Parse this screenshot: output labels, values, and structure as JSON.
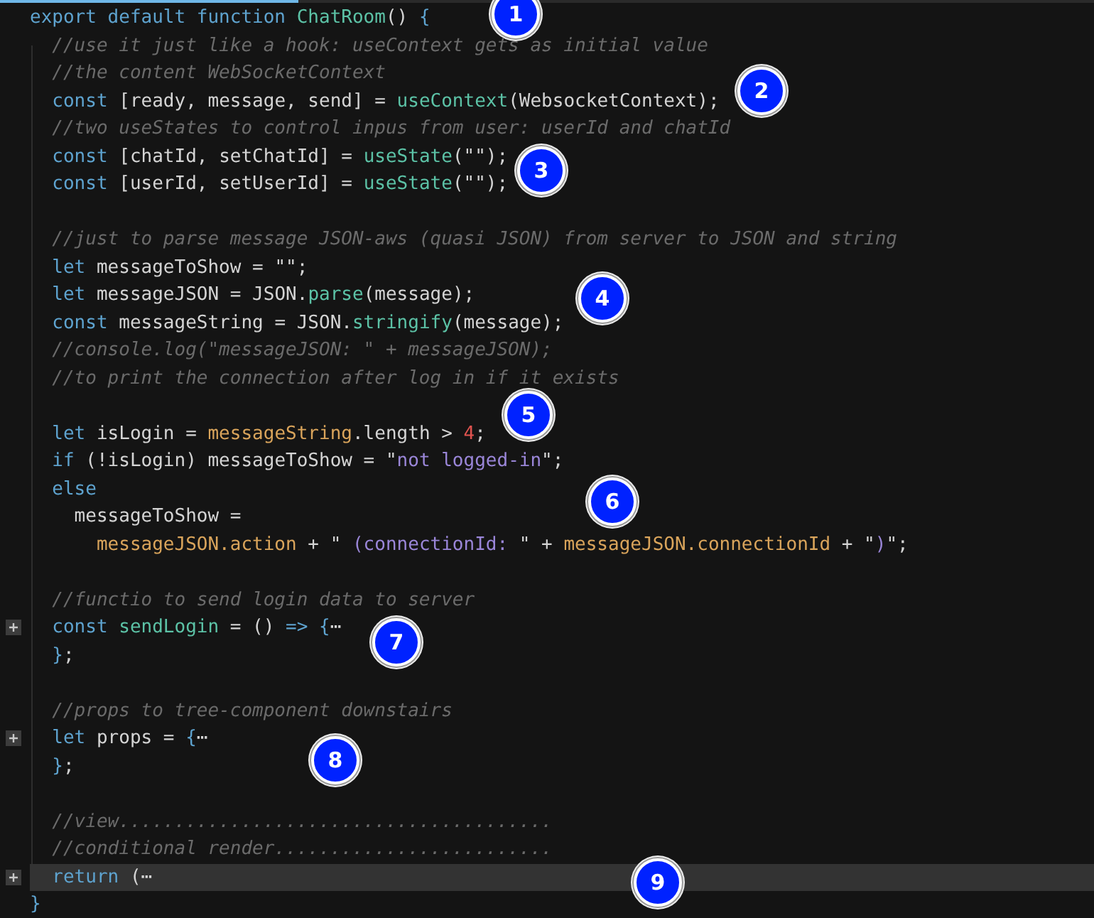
{
  "editor": {
    "lines": [
      {
        "folded": false,
        "current": false,
        "tokens": [
          {
            "kind": "kw",
            "text": "export default function "
          },
          {
            "kind": "fn",
            "text": "ChatRoom"
          },
          {
            "kind": "plain",
            "text": "() "
          },
          {
            "kind": "kw",
            "text": "{"
          }
        ]
      },
      {
        "folded": false,
        "current": false,
        "tokens": [
          {
            "kind": "comment",
            "text": "  //use it just like a hook: useContext gets as initial value"
          }
        ]
      },
      {
        "folded": false,
        "current": false,
        "tokens": [
          {
            "kind": "comment",
            "text": "  //the content WebSocketContext"
          }
        ]
      },
      {
        "folded": false,
        "current": false,
        "tokens": [
          {
            "kind": "kw",
            "text": "  const"
          },
          {
            "kind": "plain",
            "text": " [ready, message, send] = "
          },
          {
            "kind": "fn",
            "text": "useContext"
          },
          {
            "kind": "plain",
            "text": "(WebsocketContext);"
          }
        ]
      },
      {
        "folded": false,
        "current": false,
        "tokens": [
          {
            "kind": "comment",
            "text": "  //two useStates to control inpus from user: userId and chatId"
          }
        ]
      },
      {
        "folded": false,
        "current": false,
        "tokens": [
          {
            "kind": "kw",
            "text": "  const"
          },
          {
            "kind": "plain",
            "text": " [chatId, setChatId] = "
          },
          {
            "kind": "fn",
            "text": "useState"
          },
          {
            "kind": "plain",
            "text": "(\"\");"
          }
        ]
      },
      {
        "folded": false,
        "current": false,
        "tokens": [
          {
            "kind": "kw",
            "text": "  const"
          },
          {
            "kind": "plain",
            "text": " [userId, setUserId] = "
          },
          {
            "kind": "fn",
            "text": "useState"
          },
          {
            "kind": "plain",
            "text": "(\"\");"
          }
        ]
      },
      {
        "folded": false,
        "current": false
      },
      {
        "folded": false,
        "current": false,
        "tokens": [
          {
            "kind": "comment",
            "text": "  //just to parse message JSON-aws (quasi JSON) from server to JSON and string"
          }
        ]
      },
      {
        "folded": false,
        "current": false,
        "tokens": [
          {
            "kind": "kw",
            "text": "  let"
          },
          {
            "kind": "plain",
            "text": " messageToShow = \"\";"
          }
        ]
      },
      {
        "folded": false,
        "current": false,
        "tokens": [
          {
            "kind": "kw",
            "text": "  let"
          },
          {
            "kind": "plain",
            "text": " messageJSON = JSON."
          },
          {
            "kind": "fn",
            "text": "parse"
          },
          {
            "kind": "plain",
            "text": "(message);"
          }
        ]
      },
      {
        "folded": false,
        "current": false,
        "tokens": [
          {
            "kind": "kw",
            "text": "  const"
          },
          {
            "kind": "plain",
            "text": " messageString = JSON."
          },
          {
            "kind": "fn",
            "text": "stringify"
          },
          {
            "kind": "plain",
            "text": "(message);"
          }
        ]
      },
      {
        "folded": false,
        "current": false,
        "tokens": [
          {
            "kind": "comment",
            "text": "  //console.log(\"messageJSON: \" + messageJSON);"
          }
        ]
      },
      {
        "folded": false,
        "current": false,
        "tokens": [
          {
            "kind": "comment",
            "text": "  //to print the connection after log in if it exists"
          }
        ]
      },
      {
        "folded": false,
        "current": false
      },
      {
        "folded": false,
        "current": false,
        "tokens": [
          {
            "kind": "kw",
            "text": "  let"
          },
          {
            "kind": "plain",
            "text": " isLogin = "
          },
          {
            "kind": "var",
            "text": "messageString"
          },
          {
            "kind": "plain",
            "text": ".length > "
          },
          {
            "kind": "num",
            "text": "4"
          },
          {
            "kind": "plain",
            "text": ";"
          }
        ]
      },
      {
        "folded": false,
        "current": false,
        "tokens": [
          {
            "kind": "kw",
            "text": "  if"
          },
          {
            "kind": "plain",
            "text": " (!isLogin) messageToShow = \""
          },
          {
            "kind": "str",
            "text": "not logged-in"
          },
          {
            "kind": "plain",
            "text": "\";"
          }
        ]
      },
      {
        "folded": false,
        "current": false,
        "tokens": [
          {
            "kind": "kw",
            "text": "  else"
          }
        ]
      },
      {
        "folded": false,
        "current": false,
        "tokens": [
          {
            "kind": "plain",
            "text": "    messageToShow ="
          }
        ]
      },
      {
        "folded": false,
        "current": false,
        "tokens": [
          {
            "kind": "var",
            "text": "      messageJSON.action"
          },
          {
            "kind": "plain",
            "text": " + \""
          },
          {
            "kind": "str",
            "text": " (connectionId: "
          },
          {
            "kind": "plain",
            "text": "\" + "
          },
          {
            "kind": "var",
            "text": "messageJSON.connectionId"
          },
          {
            "kind": "plain",
            "text": " + \""
          },
          {
            "kind": "str",
            "text": ")"
          },
          {
            "kind": "plain",
            "text": "\";"
          }
        ]
      },
      {
        "folded": false,
        "current": false
      },
      {
        "folded": false,
        "current": false,
        "tokens": [
          {
            "kind": "comment",
            "text": "  //functio to send login data to server"
          }
        ]
      },
      {
        "folded": true,
        "current": false,
        "tokens": [
          {
            "kind": "kw",
            "text": "  const "
          },
          {
            "kind": "fn",
            "text": "sendLogin"
          },
          {
            "kind": "plain",
            "text": " = () "
          },
          {
            "kind": "kw",
            "text": "=> {"
          },
          {
            "kind": "plain",
            "text": "⋯"
          }
        ]
      },
      {
        "folded": false,
        "current": false,
        "tokens": [
          {
            "kind": "kw",
            "text": "  }"
          },
          {
            "kind": "plain",
            "text": ";"
          }
        ]
      },
      {
        "folded": false,
        "current": false
      },
      {
        "folded": false,
        "current": false,
        "tokens": [
          {
            "kind": "comment",
            "text": "  //props to tree-component downstairs"
          }
        ]
      },
      {
        "folded": true,
        "current": false,
        "tokens": [
          {
            "kind": "kw",
            "text": "  let"
          },
          {
            "kind": "plain",
            "text": " props = "
          },
          {
            "kind": "kw",
            "text": "{"
          },
          {
            "kind": "plain",
            "text": "⋯"
          }
        ]
      },
      {
        "folded": false,
        "current": false,
        "tokens": [
          {
            "kind": "kw",
            "text": "  }"
          },
          {
            "kind": "plain",
            "text": ";"
          }
        ]
      },
      {
        "folded": false,
        "current": false
      },
      {
        "folded": false,
        "current": false,
        "tokens": [
          {
            "kind": "comment",
            "text": "  //view......................................."
          }
        ]
      },
      {
        "folded": false,
        "current": false,
        "tokens": [
          {
            "kind": "comment",
            "text": "  //conditional render........................."
          }
        ]
      },
      {
        "folded": true,
        "current": true,
        "tokens": [
          {
            "kind": "kw",
            "text": "  return"
          },
          {
            "kind": "plain",
            "text": " ("
          },
          {
            "kind": "plain",
            "text": "⋯"
          }
        ]
      },
      {
        "folded": false,
        "current": false,
        "tokens": [
          {
            "kind": "kw",
            "text": "}"
          }
        ]
      }
    ]
  },
  "badges": [
    {
      "number": "1"
    },
    {
      "number": "2"
    },
    {
      "number": "3"
    },
    {
      "number": "4"
    },
    {
      "number": "5"
    },
    {
      "number": "6"
    },
    {
      "number": "7"
    },
    {
      "number": "8"
    },
    {
      "number": "9"
    }
  ]
}
